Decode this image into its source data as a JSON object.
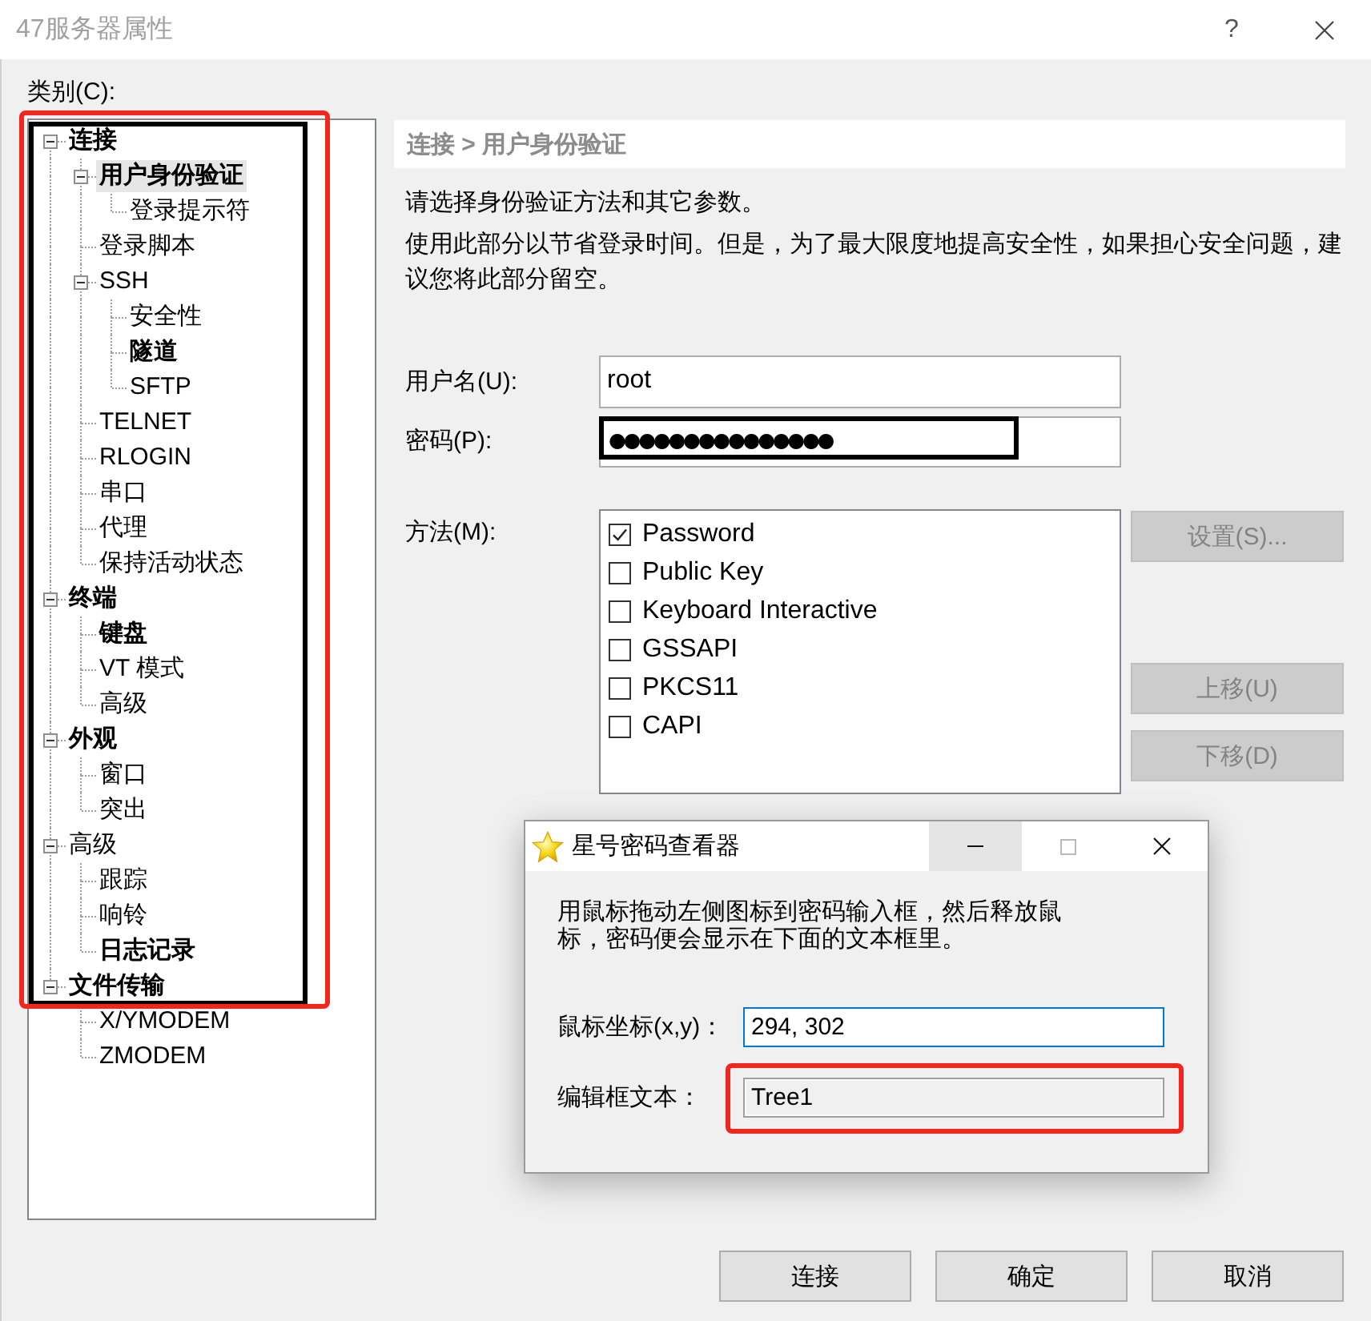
{
  "window": {
    "title": "47服务器属性",
    "active": false,
    "help": "?"
  },
  "category": {
    "label": "类别(C):",
    "tree": [
      {
        "label": "连接",
        "bold": true,
        "selected": false,
        "expanded": true,
        "children": [
          {
            "label": "用户身份验证",
            "bold": true,
            "selected": true,
            "expanded": true,
            "children": [
              {
                "label": "登录提示符",
                "bold": false,
                "selected": false
              }
            ]
          },
          {
            "label": "登录脚本",
            "bold": false,
            "selected": false
          },
          {
            "label": "SSH",
            "bold": false,
            "selected": false,
            "expanded": true,
            "children": [
              {
                "label": "安全性",
                "bold": false,
                "selected": false
              },
              {
                "label": "隧道",
                "bold": true,
                "selected": false
              },
              {
                "label": "SFTP",
                "bold": false,
                "selected": false
              }
            ]
          },
          {
            "label": "TELNET",
            "bold": false,
            "selected": false
          },
          {
            "label": "RLOGIN",
            "bold": false,
            "selected": false
          },
          {
            "label": "串口",
            "bold": false,
            "selected": false
          },
          {
            "label": "代理",
            "bold": false,
            "selected": false
          },
          {
            "label": "保持活动状态",
            "bold": false,
            "selected": false
          }
        ]
      },
      {
        "label": "终端",
        "bold": true,
        "selected": false,
        "expanded": true,
        "children": [
          {
            "label": "键盘",
            "bold": true,
            "selected": false
          },
          {
            "label": "VT 模式",
            "bold": false,
            "selected": false
          },
          {
            "label": "高级",
            "bold": false,
            "selected": false
          }
        ]
      },
      {
        "label": "外观",
        "bold": true,
        "selected": false,
        "expanded": true,
        "children": [
          {
            "label": "窗口",
            "bold": false,
            "selected": false
          },
          {
            "label": "突出",
            "bold": false,
            "selected": false
          }
        ]
      },
      {
        "label": "高级",
        "bold": false,
        "selected": false,
        "expanded": true,
        "children": [
          {
            "label": "跟踪",
            "bold": false,
            "selected": false
          },
          {
            "label": "响铃",
            "bold": false,
            "selected": false
          },
          {
            "label": "日志记录",
            "bold": true,
            "selected": false
          }
        ]
      },
      {
        "label": "文件传输",
        "bold": true,
        "selected": false,
        "expanded": true,
        "children": [
          {
            "label": "X/YMODEM",
            "bold": false,
            "selected": false
          },
          {
            "label": "ZMODEM",
            "bold": false,
            "selected": false
          }
        ]
      }
    ]
  },
  "panel": {
    "breadcrumb": "连接 > 用户身份验证",
    "description": [
      "请选择身份验证方法和其它参数。",
      "使用此部分以节省登录时间。但是，为了最大限度地提高安全性，如果担心安全问题，建议您将此部分留空。"
    ],
    "username": {
      "label": "用户名(U):",
      "value": "root"
    },
    "password": {
      "label": "密码(P):",
      "value": "●●●●●●●●●●●●●●●"
    },
    "methods": {
      "label": "方法(M):",
      "items": [
        {
          "label": "Password",
          "checked": true
        },
        {
          "label": "Public Key",
          "checked": false
        },
        {
          "label": "Keyboard Interactive",
          "checked": false
        },
        {
          "label": "GSSAPI",
          "checked": false
        },
        {
          "label": "PKCS11",
          "checked": false
        },
        {
          "label": "CAPI",
          "checked": false
        }
      ]
    },
    "method_buttons": [
      {
        "label": "设置(S)...",
        "disabled": true
      },
      {
        "label": "上移(U)",
        "disabled": true
      },
      {
        "label": "下移(D)",
        "disabled": true
      }
    ]
  },
  "dialog_buttons": [
    "连接",
    "确定",
    "取消"
  ],
  "viewer_window": {
    "title": "星号密码查看器",
    "caption_buttons": [
      {
        "kind": "minimize",
        "hovered": true,
        "disabled": false
      },
      {
        "kind": "maximize",
        "hovered": false,
        "disabled": true
      },
      {
        "kind": "close",
        "hovered": false,
        "disabled": false
      }
    ],
    "instructions": "用鼠标拖动左侧图标到密码输入框，然后释放鼠标，密码便会显示在下面的文本框里。",
    "coordinates": {
      "label": "鼠标坐标(x,y)：",
      "value": "294, 302"
    },
    "edit_text": {
      "label": "编辑框文本：",
      "value": "Tree1"
    }
  }
}
